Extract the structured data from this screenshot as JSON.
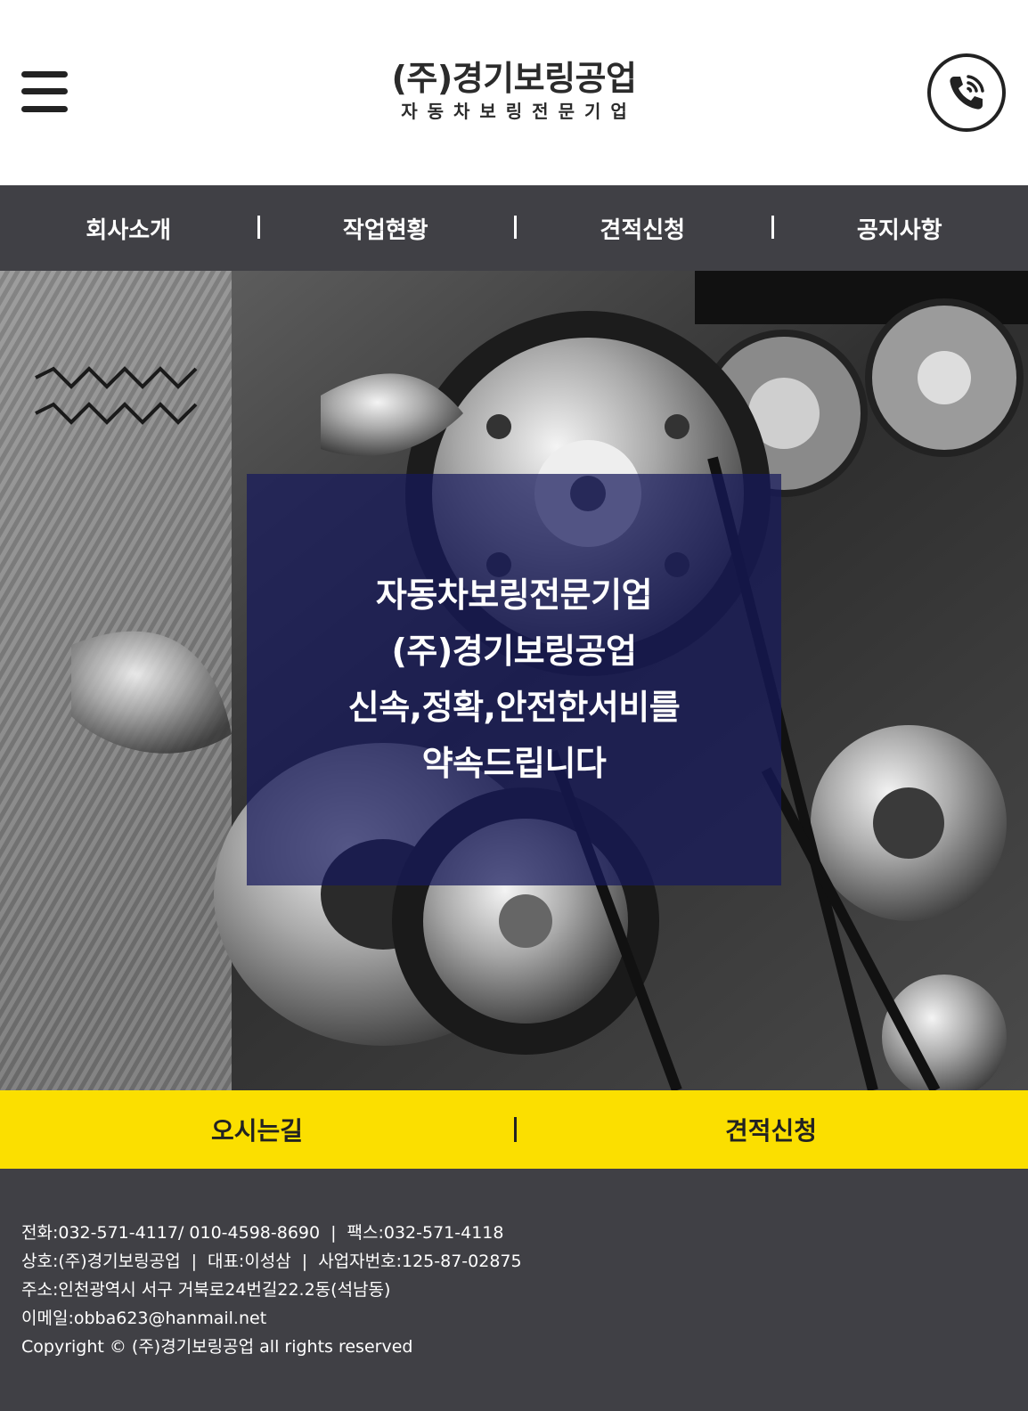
{
  "header": {
    "brand_name": "(주)경기보링공업",
    "brand_sub": "자동차보링전문기업",
    "menu_icon": "hamburger-menu-icon",
    "call_icon": "phone-call-icon"
  },
  "nav": {
    "items": [
      {
        "label": "회사소개"
      },
      {
        "label": "작업현황"
      },
      {
        "label": "견적신청"
      },
      {
        "label": "공지사항"
      }
    ]
  },
  "hero": {
    "lines": [
      "자동차보링전문기업",
      "(주)경기보링공업",
      "신속,정확,안전한서비를",
      "약속드립니다"
    ],
    "overlay_color": "#16195c"
  },
  "quick_links": {
    "items": [
      {
        "label": "오시는길"
      },
      {
        "label": "견적신청"
      }
    ],
    "bg_color": "#fbdf00"
  },
  "footer": {
    "phone": "전화:032-571-4117/ 010-4598-8690",
    "fax": "팩스:032-571-4118",
    "company": "상호:(주)경기보링공업",
    "ceo": "대표:이성삼",
    "biz_no": "사업자번호:125-87-02875",
    "address": "주소:인천광역시 서구 거북로24번길22.2동(석남동)",
    "email": "이메일:obba623@hanmail.net",
    "copyright": "Copyright © (주)경기보링공업 all rights reserved",
    "separator": "|",
    "bg_color": "#404045"
  }
}
